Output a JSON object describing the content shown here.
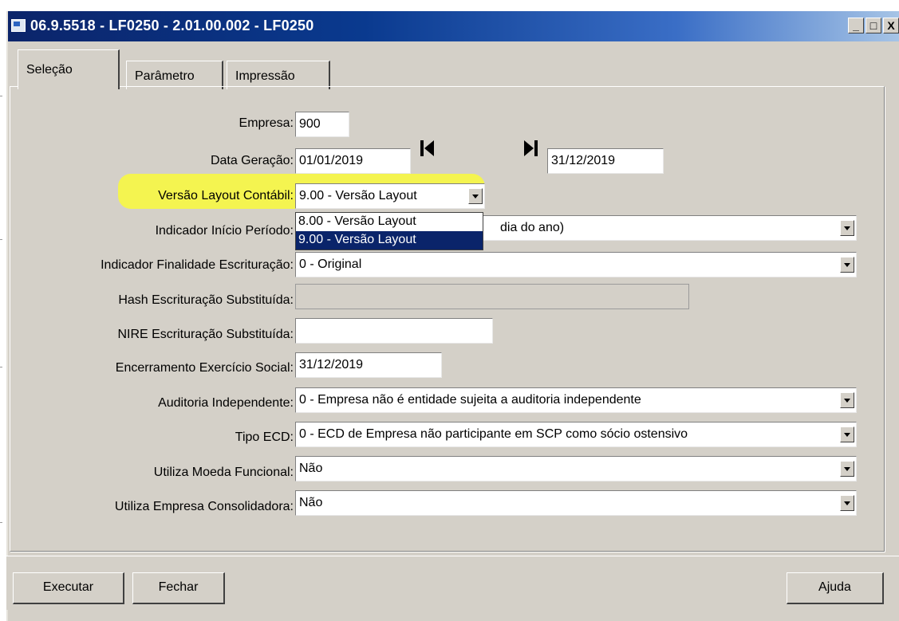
{
  "window": {
    "title": "06.9.5518 - LF0250 - 2.01.00.002 - LF0250",
    "minimize_glyph": "_",
    "maximize_glyph": "□",
    "close_glyph": "X"
  },
  "tabs": [
    {
      "label": "Seleção",
      "active": true
    },
    {
      "label": "Parâmetro",
      "active": false
    },
    {
      "label": "Impressão",
      "active": false
    }
  ],
  "form": {
    "empresa": {
      "label": "Empresa:",
      "value": "900"
    },
    "data_geracao": {
      "label": "Data Geração:",
      "from": "01/01/2019",
      "to": "31/12/2019"
    },
    "versao_layout": {
      "label": "Versão Layout Contábil:",
      "value": "9.00 - Versão Layout"
    },
    "indicador_inicio": {
      "label": "Indicador Início Período:",
      "value_visible_tail": "dia do ano)"
    },
    "indicador_finalidade": {
      "label": "Indicador Finalidade Escrituração:",
      "value": "0 - Original"
    },
    "hash_escrituracao": {
      "label": "Hash Escrituração Substituída:",
      "value": ""
    },
    "nire_escrituracao": {
      "label": "NIRE Escrituração Substituída:",
      "value": ""
    },
    "encerramento": {
      "label": "Encerramento Exercício Social:",
      "value": "31/12/2019"
    },
    "auditoria": {
      "label": "Auditoria Independente:",
      "value": "0 - Empresa não é entidade sujeita a auditoria independente"
    },
    "tipo_ecd": {
      "label": "Tipo ECD:",
      "value": "0 - ECD de Empresa não participante em SCP como sócio ostensivo"
    },
    "moeda_funcional": {
      "label": "Utiliza Moeda Funcional:",
      "value": "Não"
    },
    "empresa_consolidadora": {
      "label": "Utiliza Empresa Consolidadora:",
      "value": "Não"
    }
  },
  "versao_dropdown_options": [
    {
      "label": "8.00 - Versão Layout",
      "selected": false
    },
    {
      "label": "9.00 - Versão Layout",
      "selected": true
    }
  ],
  "buttons": {
    "executar": "Executar",
    "fechar": "Fechar",
    "ajuda": "Ajuda"
  },
  "colors": {
    "title_bar": "#0b246a",
    "highlight": "#f5f54a",
    "selection": "#0a246a",
    "window_bg": "#d4d0c8"
  },
  "icons": {
    "first": "skip-to-start-icon",
    "last": "skip-to-end-icon",
    "dropdown": "chevron-down-icon"
  }
}
